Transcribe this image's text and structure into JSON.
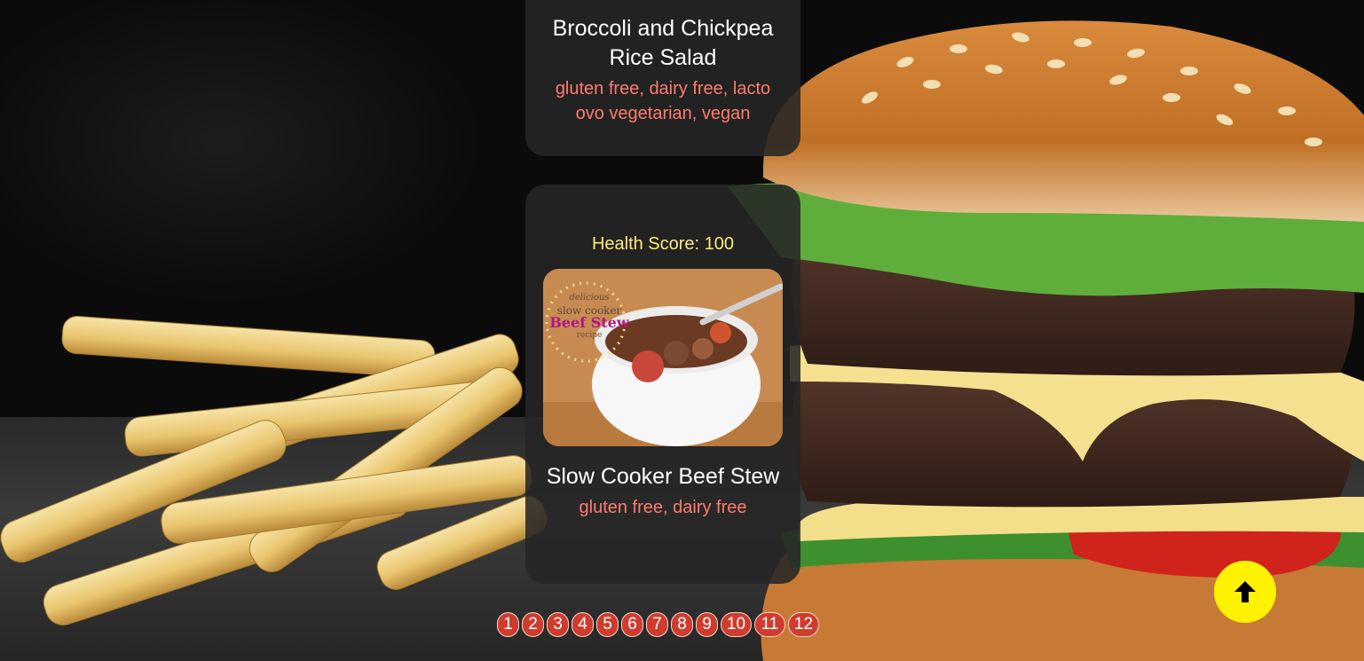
{
  "recipes": [
    {
      "title": "Broccoli and Chickpea Rice Salad",
      "diets": "gluten free, dairy free, lacto ovo vegetarian, vegan"
    },
    {
      "health_score_label": "Health Score: 100",
      "image_text": {
        "line1": "delicious",
        "line2": "slow cooker",
        "line3": "Beef Stew",
        "line4": "recipe"
      },
      "title": "Slow Cooker Beef Stew",
      "diets": "gluten free, dairy free"
    }
  ],
  "pagination": {
    "pages": [
      "1",
      "2",
      "3",
      "4",
      "5",
      "6",
      "7",
      "8",
      "9",
      "10",
      "11",
      "12"
    ]
  },
  "scroll_top": {
    "icon": "arrow-up-icon"
  },
  "colors": {
    "card_bg": "#262626",
    "diets_text": "#ff7b6e",
    "health_score_text": "#ffe97a",
    "page_button": "#cf3c2e",
    "scroll_top_button": "#fff200"
  }
}
